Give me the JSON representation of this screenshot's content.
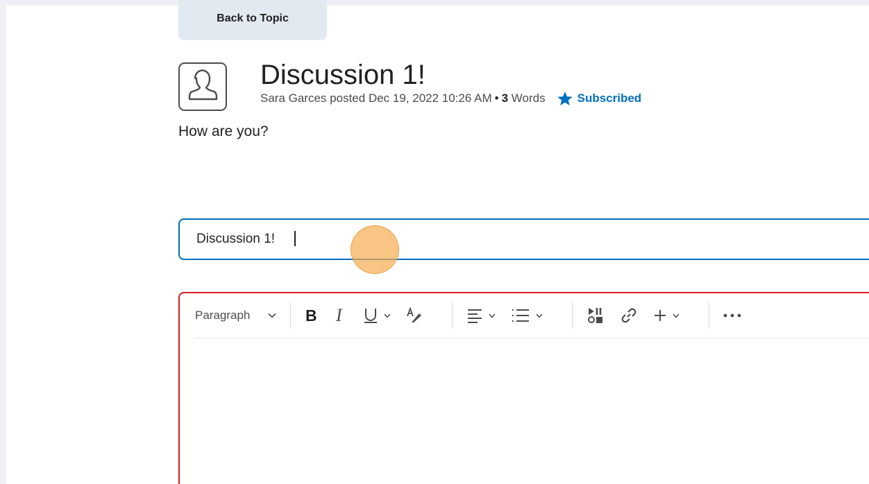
{
  "nav": {
    "back_label": "Back to Topic"
  },
  "post": {
    "title": "Discussion 1!",
    "author": "Sara Garces",
    "posted_verb": "posted",
    "date": "Dec 19, 2022 10:26 AM",
    "word_count": "3",
    "word_label": "Words",
    "subscribed_label": "Subscribed",
    "body": "How are you?"
  },
  "reply": {
    "subject_value": "Discussion 1!"
  },
  "editor": {
    "format_select": "Paragraph",
    "tools": [
      {
        "icon": "bold-icon"
      },
      {
        "icon": "italic-icon"
      },
      {
        "icon": "underline-icon"
      },
      {
        "icon": "text-color-icon"
      },
      {
        "icon": "align-icon"
      },
      {
        "icon": "list-icon"
      },
      {
        "icon": "media-icon"
      },
      {
        "icon": "link-icon"
      },
      {
        "icon": "insert-plus-icon"
      },
      {
        "icon": "more-icon"
      }
    ]
  },
  "colors": {
    "accent": "#006fbf",
    "error_border": "#cd2026",
    "button_bg": "#e3e9f1",
    "click_indicator": "#f7ad50"
  }
}
